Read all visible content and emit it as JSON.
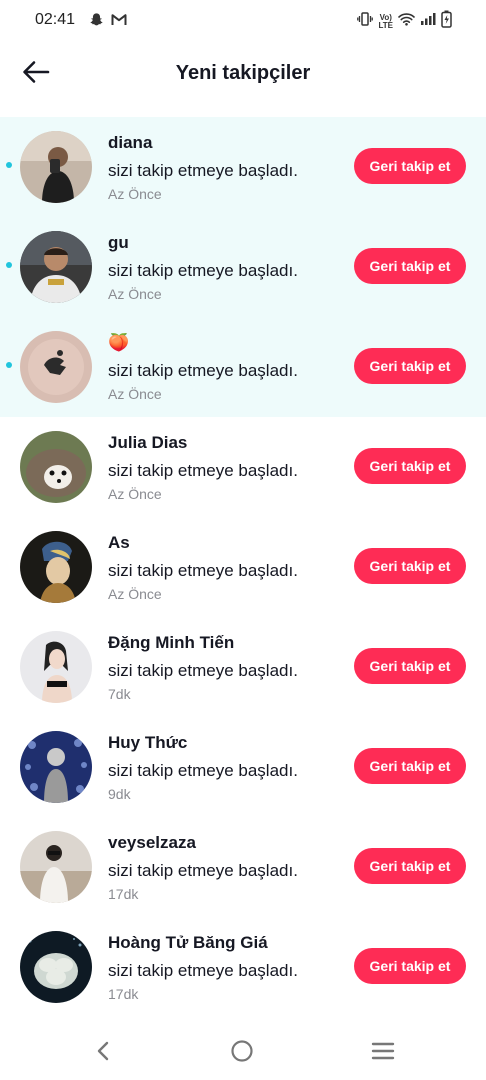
{
  "status_bar": {
    "time": "02:41",
    "left_icons": [
      "snapchat-icon",
      "gmail-icon"
    ],
    "right_icons": [
      "vibrate-icon",
      "volte-lte-icon",
      "wifi-icon",
      "signal-icon",
      "battery-charging-icon"
    ],
    "lte_top": "Vo)",
    "lte_bottom": "LTE"
  },
  "header": {
    "title": "Yeni takipçiler",
    "back_icon": "arrow-left-icon"
  },
  "colors": {
    "accent": "#fe2c55",
    "new_row_bg": "#eefbfb",
    "unread_dot": "#20c5dd",
    "secondary_text": "#8a8b91"
  },
  "followers": [
    {
      "name": "diana",
      "action": "sizi takip etmeye başladı.",
      "time": "Az Önce",
      "button": "Geri takip et",
      "is_new": true
    },
    {
      "name": "gu",
      "action": "sizi takip etmeye başladı.",
      "time": "Az Önce",
      "button": "Geri takip et",
      "is_new": true
    },
    {
      "name": "🍑",
      "action": "sizi takip etmeye başladı.",
      "time": "Az Önce",
      "button": "Geri takip et",
      "is_new": true
    },
    {
      "name": "Julia Dias",
      "action": "sizi takip etmeye başladı.",
      "time": "Az Önce",
      "button": "Geri takip et",
      "is_new": false
    },
    {
      "name": "As",
      "action": "sizi takip etmeye başladı.",
      "time": "Az Önce",
      "button": "Geri takip et",
      "is_new": false
    },
    {
      "name": "Đặng Minh Tiến",
      "action": "sizi takip etmeye başladı.",
      "time": "7dk",
      "button": "Geri takip et",
      "is_new": false
    },
    {
      "name": "Huy Thức",
      "action": "sizi takip etmeye başladı.",
      "time": "9dk",
      "button": "Geri takip et",
      "is_new": false
    },
    {
      "name": "veyselzaza",
      "action": "sizi takip etmeye başladı.",
      "time": "17dk",
      "button": "Geri takip et",
      "is_new": false
    },
    {
      "name": "Hoàng Tử Băng Giá",
      "action": "sizi takip etmeye başladı.",
      "time": "17dk",
      "button": "Geri takip et",
      "is_new": false
    }
  ],
  "nav_bar": {
    "icons": [
      "back-triangle-icon",
      "home-circle-icon",
      "menu-lines-icon"
    ]
  }
}
